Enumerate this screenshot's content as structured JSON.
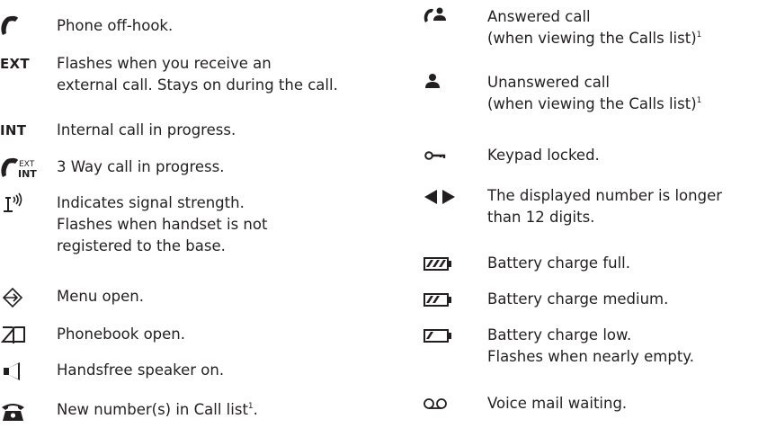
{
  "left_items": [
    {
      "icon": "handset-icon",
      "lines": [
        "Phone off-hook."
      ]
    },
    {
      "icon": "ext-indicator",
      "icon_text": "EXT",
      "lines": [
        "Flashes when you receive an",
        "external call. Stays on during the call."
      ]
    },
    {
      "icon": "int-indicator",
      "icon_text": "INT",
      "lines": [
        "Internal call in progress."
      ]
    },
    {
      "icon": "three-way-call-icon",
      "icon_text_top": "EXT",
      "icon_text_bottom": "INT",
      "lines": [
        "3 Way call in progress."
      ]
    },
    {
      "icon": "signal-strength-icon",
      "lines": [
        "Indicates signal strength.",
        "Flashes when handset is not",
        "registered to the base."
      ]
    },
    {
      "icon": "menu-icon",
      "lines": [
        "Menu open."
      ]
    },
    {
      "icon": "phonebook-icon",
      "lines": [
        "Phonebook open."
      ]
    },
    {
      "icon": "speaker-icon",
      "lines": [
        "Handsfree speaker on."
      ]
    },
    {
      "icon": "telephone-icon",
      "lines": [
        "New number(s) in Call list"
      ],
      "footnote": "1",
      "suffix": "."
    }
  ],
  "right_items": [
    {
      "icon": "answered-call-icon",
      "lines": [
        "Answered call",
        "(when viewing the Calls list)"
      ],
      "footnote": "1"
    },
    {
      "icon": "unanswered-call-icon",
      "lines": [
        "Unanswered call",
        "(when viewing the Calls list)"
      ],
      "footnote": "1"
    },
    {
      "icon": "key-icon",
      "lines": [
        "Keypad locked."
      ]
    },
    {
      "icon": "scroll-arrows-icon",
      "lines": [
        "The displayed number is longer",
        "than 12 digits."
      ]
    },
    {
      "icon": "battery-full-icon",
      "lines": [
        "Battery charge full."
      ]
    },
    {
      "icon": "battery-medium-icon",
      "lines": [
        "Battery charge medium."
      ]
    },
    {
      "icon": "battery-low-icon",
      "lines": [
        "Battery charge low.",
        "Flashes when nearly empty."
      ]
    },
    {
      "icon": "voicemail-icon",
      "lines": [
        "Voice mail waiting."
      ]
    }
  ]
}
